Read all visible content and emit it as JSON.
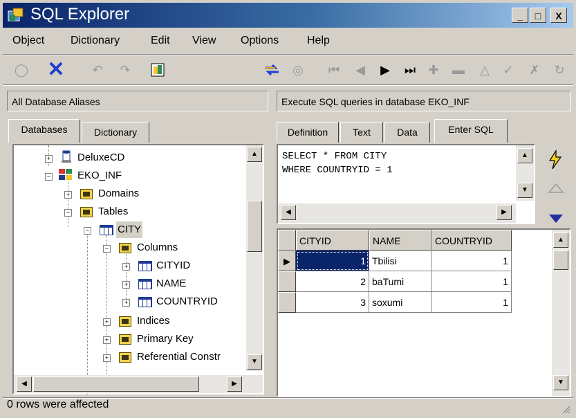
{
  "window": {
    "title": "SQL Explorer",
    "minimize": "_",
    "maximize": "□",
    "close": "X"
  },
  "menu": [
    "Object",
    "Dictionary",
    "Edit",
    "View",
    "Options",
    "Help"
  ],
  "panels": {
    "left_header": "All Database Aliases",
    "right_header": "Execute SQL queries in database EKO_INF"
  },
  "left_tabs": [
    "Databases",
    "Dictionary"
  ],
  "right_tabs": [
    "Definition",
    "Text",
    "Data",
    "Enter SQL"
  ],
  "tree": {
    "deluxecd": "DeluxeCD",
    "eko_inf": "EKO_INF",
    "domains": "Domains",
    "tables": "Tables",
    "city": "CITY",
    "columns": "Columns",
    "cityid": "CITYID",
    "name": "NAME",
    "countryid": "COUNTRYID",
    "indices": "Indices",
    "primary_key": "Primary Key",
    "ref_constr": "Referential Constr"
  },
  "sql": {
    "line1": "SELECT * FROM CITY",
    "line2": "WHERE COUNTRYID = 1"
  },
  "grid": {
    "headers": [
      "CITYID",
      "NAME",
      "COUNTRYID"
    ],
    "rows": [
      [
        "1",
        "Tbilisi",
        "1"
      ],
      [
        "2",
        "baTumi",
        "1"
      ],
      [
        "3",
        "soxumi",
        "1"
      ]
    ]
  },
  "status": "0 rows were affected"
}
